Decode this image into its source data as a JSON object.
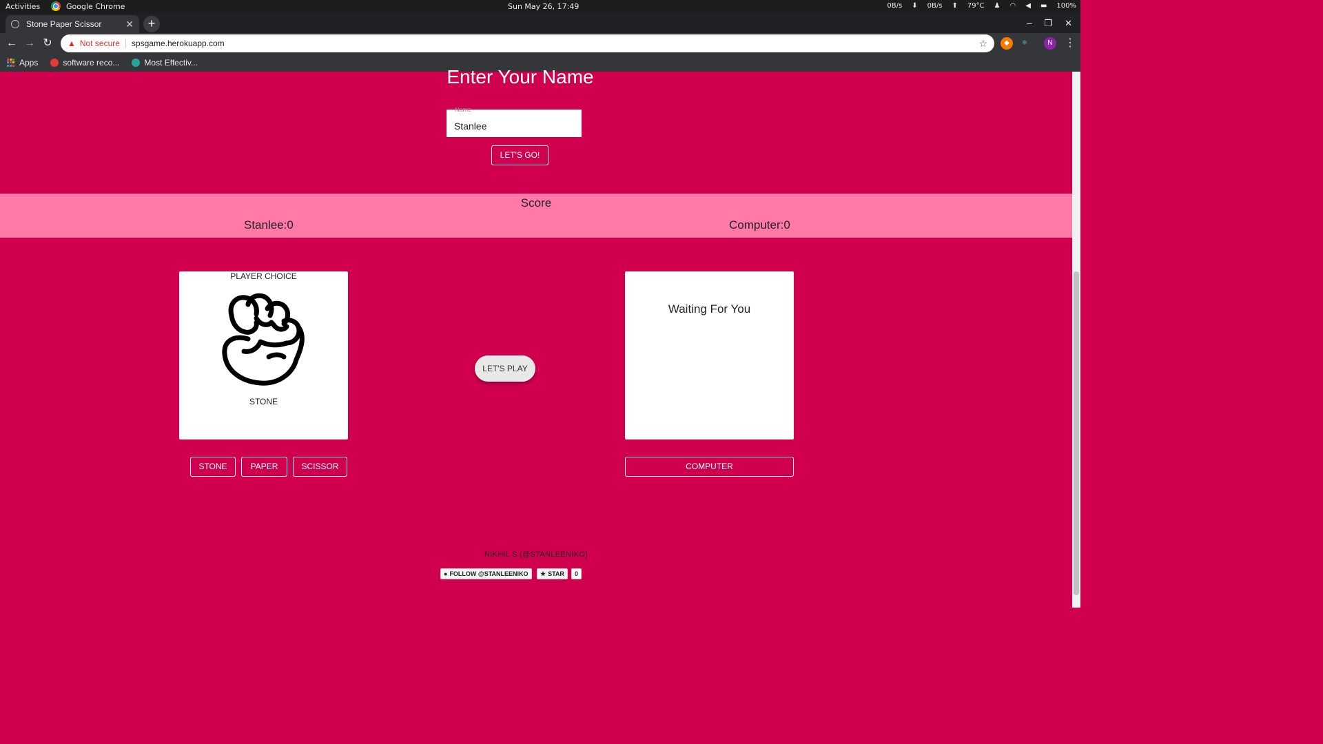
{
  "system_bar": {
    "activities": "Activities",
    "app_name": "Google Chrome",
    "clock": "Sun May 26, 17:49",
    "net_down": "0B/s",
    "net_up": "0B/s",
    "temperature": "79°C",
    "battery": "100%"
  },
  "browser": {
    "tab_title": "Stone Paper Scissor",
    "security_label": "Not secure",
    "url": "spsgame.herokuapp.com",
    "profile_initial": "N",
    "bookmarks": [
      {
        "label": "Apps"
      },
      {
        "label": "software reco..."
      },
      {
        "label": "Most Effectiv..."
      }
    ]
  },
  "page": {
    "title": "Enter Your Name",
    "name_field": {
      "label": "Name",
      "value": "Stanlee"
    },
    "submit_label": "LET'S GO!",
    "score": {
      "title": "Score",
      "player": "Stanlee:0",
      "computer": "Computer:0"
    },
    "player_card": {
      "header": "PLAYER CHOICE",
      "choice": "STONE"
    },
    "computer_card": {
      "status": "Waiting For You"
    },
    "play_label": "LET'S PLAY",
    "choice_buttons": [
      "STONE",
      "PAPER",
      "SCISSOR"
    ],
    "computer_button": "COMPUTER",
    "footer": {
      "credit": "NIKHIL S (@STANLEENIKO)",
      "follow_label": "FOLLOW @STANLEENIKO",
      "star_label": "STAR",
      "star_count": "0"
    }
  },
  "colors": {
    "page_bg": "#d1004f",
    "score_bg": "#ff7aa8"
  }
}
